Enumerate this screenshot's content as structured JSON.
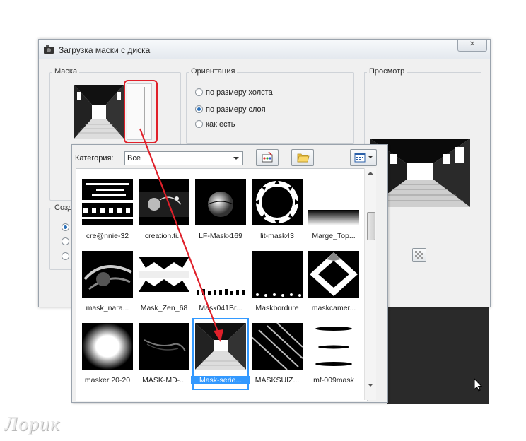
{
  "window": {
    "title": "Загрузка маски с диска",
    "close_label": "✕"
  },
  "mask_group": {
    "label": "Маска"
  },
  "orientation": {
    "label": "Ориентация",
    "options": [
      {
        "label": "по размеру холста",
        "checked": false
      },
      {
        "label": "по размеру слоя",
        "checked": true
      },
      {
        "label": "как есть",
        "checked": false
      }
    ]
  },
  "preview": {
    "label": "Просмотр"
  },
  "create_group": {
    "label": "Созд"
  },
  "category": {
    "label": "Категория:",
    "value": "Все"
  },
  "thumbnails": [
    {
      "label": "cre@nnie-32"
    },
    {
      "label": "creation.ti..."
    },
    {
      "label": "LF-Mask-169"
    },
    {
      "label": "lit-mask43"
    },
    {
      "label": "Marge_Top..."
    },
    {
      "label": "mask_nara..."
    },
    {
      "label": "Mask_Zen_68"
    },
    {
      "label": "Mask041Br..."
    },
    {
      "label": "Maskbordure"
    },
    {
      "label": "maskcamer..."
    },
    {
      "label": "masker 20-20"
    },
    {
      "label": "MASK-MD-..."
    },
    {
      "label": "Mask-serie...",
      "selected": true
    },
    {
      "label": "MASKSUIZ..."
    },
    {
      "label": "mf-009mask"
    }
  ],
  "watermark": "Лорик",
  "colors": {
    "selection": "#3399ff",
    "annotation": "#e0202a"
  }
}
